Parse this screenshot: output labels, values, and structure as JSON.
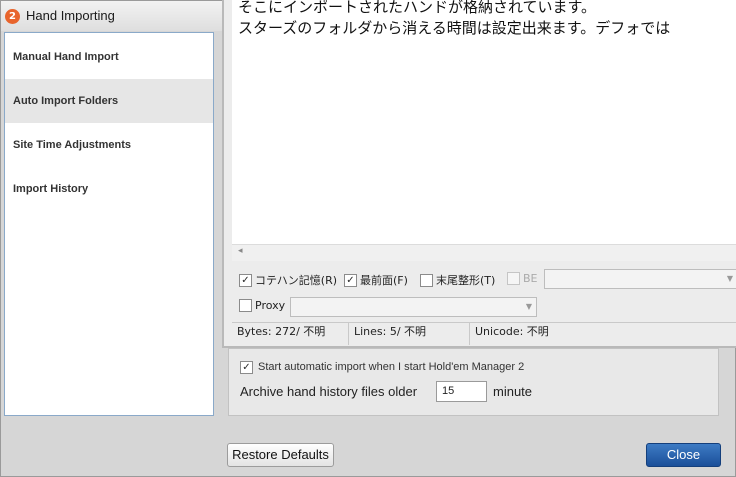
{
  "window": {
    "title": "Hand Importing",
    "logo_text": "2"
  },
  "sidebar": {
    "items": [
      {
        "label": "Manual Hand Import"
      },
      {
        "label": "Auto Import Folders"
      },
      {
        "label": "Site Time Adjustments"
      },
      {
        "label": "Import History"
      }
    ],
    "selected_index": 1
  },
  "auto_import": {
    "start_checkbox_label": "Start automatic import when I start Hold'em Manager 2",
    "start_checked": true,
    "archive_label": "Archive hand history files older",
    "archive_value": "15",
    "archive_unit": "minute"
  },
  "footer": {
    "restore_label": "Restore Defaults",
    "close_label": "Close"
  },
  "editor": {
    "lines": [
      "そこにインポートされたハンドが格納されています。",
      "スターズのフォルダから消える時間は設定出来ます。デフォでは"
    ],
    "options": {
      "keep_caret_label": "コテハン記憶(R)",
      "keep_caret_checked": true,
      "topmost_label": "最前面(F)",
      "topmost_checked": true,
      "trim_tail_label": "末尾整形(T)",
      "trim_tail_checked": false,
      "be_label": "BE",
      "be_checked": false,
      "proxy_label": "Proxy",
      "proxy_checked": false
    },
    "status": {
      "bytes": "Bytes:    272/  不明",
      "lines": "Lines:     5/ 不明",
      "unicode": "Unicode: 不明"
    }
  },
  "icons": {
    "check": "✓",
    "scroll_left": "◂",
    "dropdown": "▼"
  },
  "colors": {
    "close_button": "#1b4f99",
    "nav_border": "#8aa9c9",
    "logo": "#e8642c"
  }
}
